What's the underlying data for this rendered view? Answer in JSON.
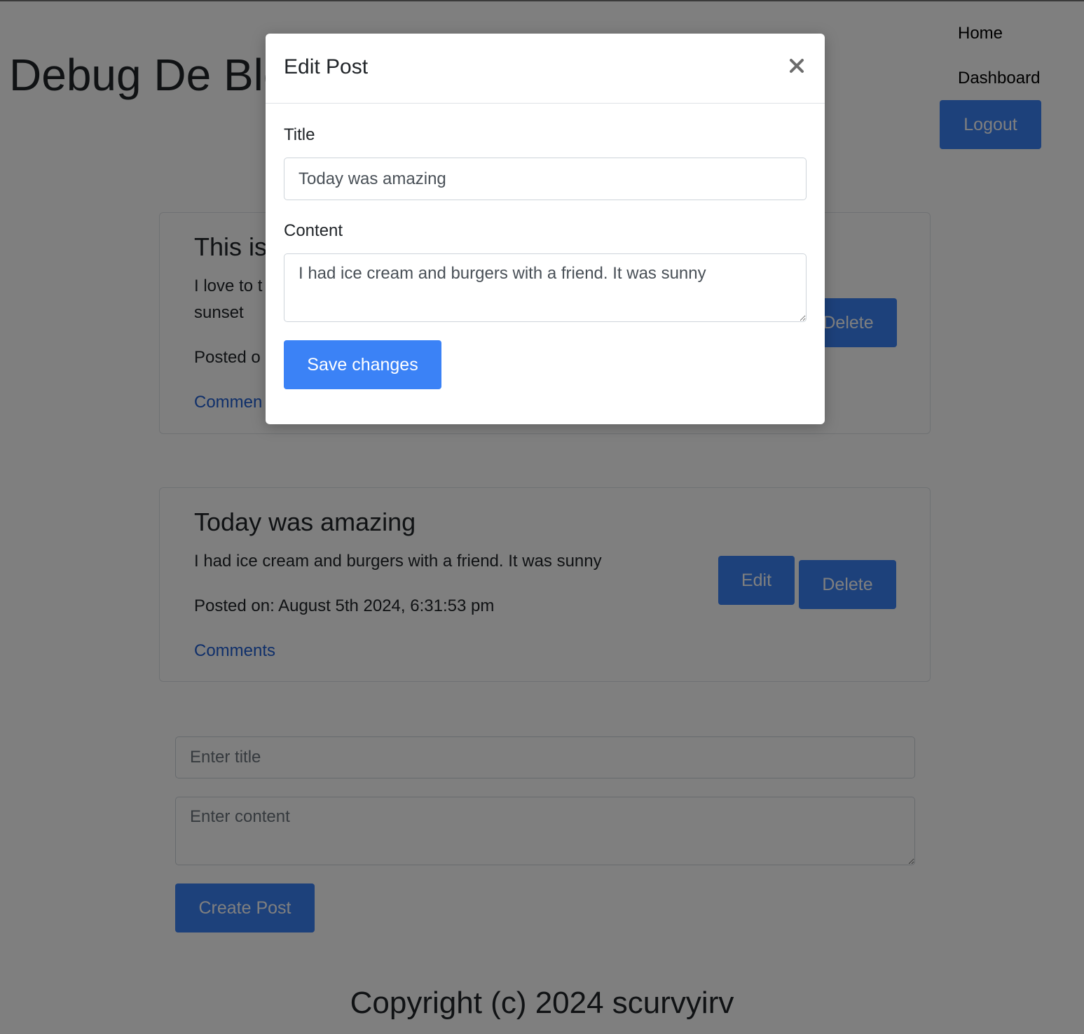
{
  "site": {
    "title": "Debug De Blog"
  },
  "nav": {
    "home": "Home",
    "dashboard": "Dashboard",
    "logout": "Logout"
  },
  "posts": [
    {
      "title": "This is",
      "content": "I love to t… sunset",
      "content_line1": "I love to t",
      "content_line2": "sunset",
      "posted_on": "Posted o",
      "comments": "Commen",
      "delete_label": "Delete"
    },
    {
      "title": "Today was amazing",
      "content": "I had ice cream and burgers with a friend. It was sunny",
      "posted_on": "Posted on: August 5th 2024, 6:31:53 pm",
      "comments": "Comments",
      "edit_label": "Edit",
      "delete_label": "Delete"
    }
  ],
  "create_form": {
    "title_placeholder": "Enter title",
    "content_placeholder": "Enter content",
    "submit_label": "Create Post"
  },
  "footer": {
    "text": "Copyright (c) 2024 scurvyirv"
  },
  "modal": {
    "title": "Edit Post",
    "title_label": "Title",
    "title_value": "Today was amazing",
    "content_label": "Content",
    "content_value": "I had ice cream and burgers with a friend. It was sunny",
    "save_label": "Save changes",
    "close_icon": "close-icon"
  },
  "colors": {
    "primary": "#3b82f6",
    "link": "#1e5ed4",
    "backdrop": "rgba(0,0,0,0.5)"
  }
}
